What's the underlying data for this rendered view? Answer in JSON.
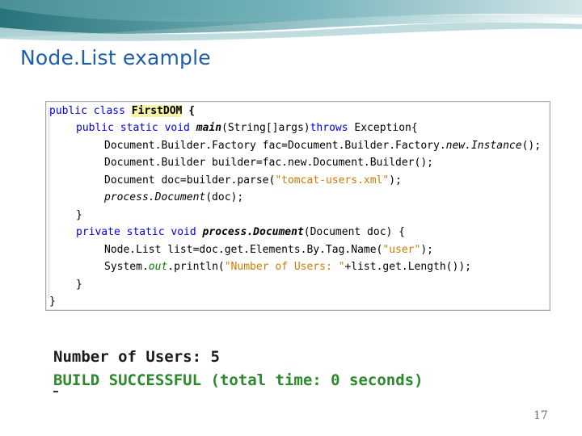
{
  "slide": {
    "title": "Node.List example",
    "page_number": "17"
  },
  "code": {
    "l1_kw": "public class ",
    "l1_name": "FirstDOM",
    "l1_end": " {",
    "l2_kw": "public static void ",
    "l2_name": "main",
    "l2_args": "(String[]args)",
    "l2_throws": "throws",
    "l2_end": " Exception{",
    "l3_a": "Document.Builder.Factory fac=Document.Builder.Factory.",
    "l3_b": "new.Instance",
    "l3_c": "();",
    "l4": "Document.Builder builder=fac.new.Document.Builder();",
    "l5_a": "Document doc=builder.parse(",
    "l5_str": "\"tomcat-users.xml\"",
    "l5_c": ");",
    "l6_a": "process.Document",
    "l6_b": "(doc);",
    "l7": "}",
    "l8_kw": "private static void ",
    "l8_name": "process.Document",
    "l8_args": "(Document doc) {",
    "l9_a": "Node.List list=doc.get.Elements.By.Tag.Name(",
    "l9_str": "\"user\"",
    "l9_c": ");",
    "l10_a": "System.",
    "l10_out": "out",
    "l10_b": ".println(",
    "l10_str": "\"Number of Users: \"",
    "l10_c": "+list.get.Length());",
    "l11": "}",
    "l12": "}"
  },
  "output": {
    "line1": "Number of Users: 5",
    "line2": "BUILD SUCCESSFUL (total time: 0 seconds)"
  },
  "colors": {
    "title": "#1f5fa8",
    "keyword": "#0000e6",
    "string": "#ce7b00",
    "build_success": "#2a8a2a",
    "highlight": "#f6f3a6"
  }
}
